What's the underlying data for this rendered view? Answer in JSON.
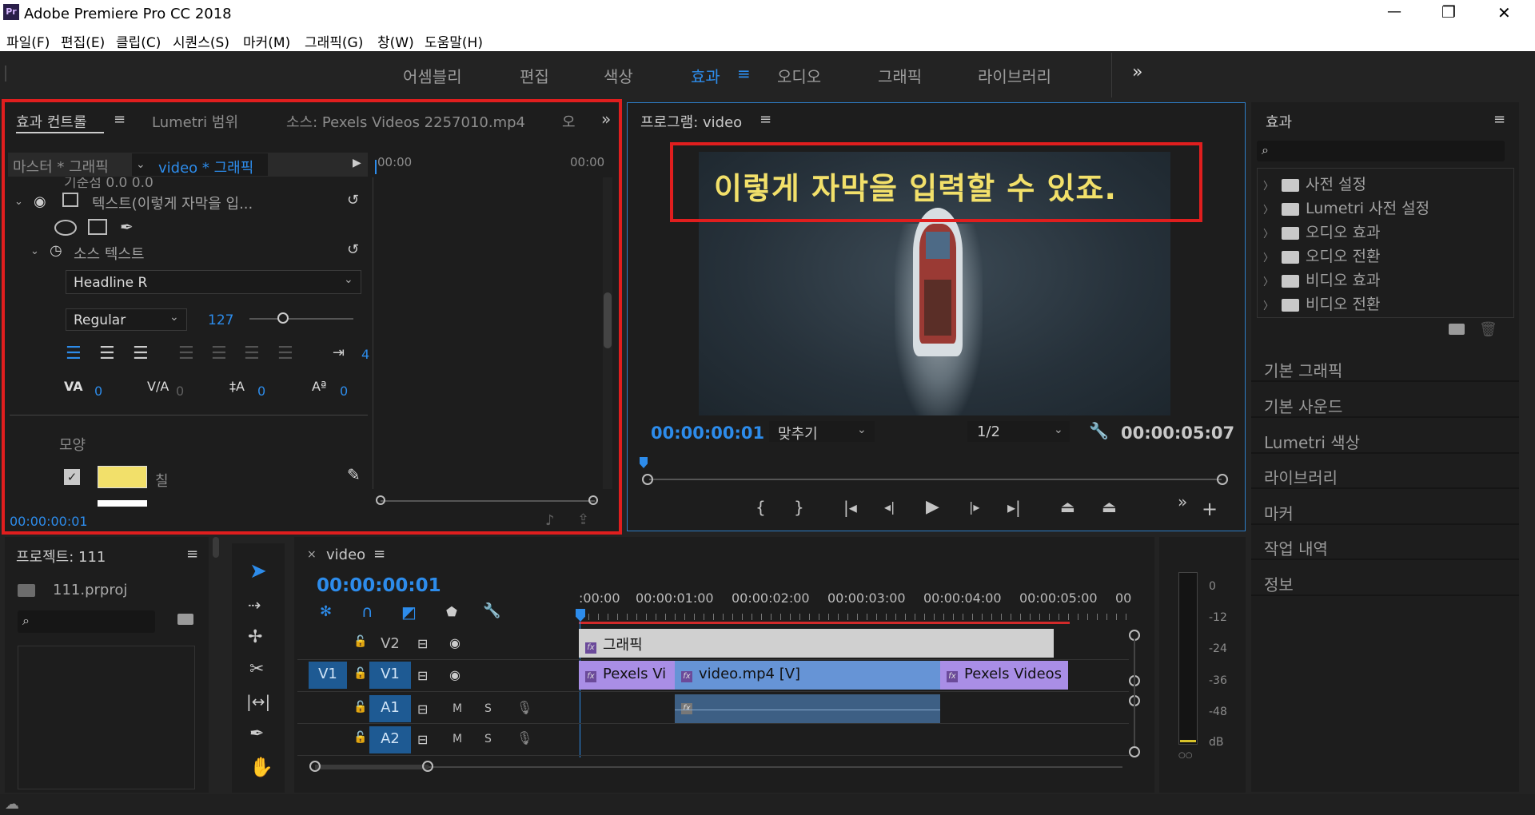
{
  "app": {
    "title": "Adobe Premiere Pro CC 2018",
    "logo": "Pr"
  },
  "window": {
    "minimize": "—",
    "restore": "❐",
    "close": "✕"
  },
  "menu": [
    "파일(F)",
    "편집(E)",
    "클립(C)",
    "시퀀스(S)",
    "마커(M)",
    "그래픽(G)",
    "창(W)",
    "도움말(H)"
  ],
  "workspaces": {
    "items": [
      "어셈블리",
      "편집",
      "색상",
      "효과",
      "오디오",
      "그래픽",
      "라이브러리"
    ],
    "active": "효과",
    "more": "»"
  },
  "effect_controls": {
    "tabs": [
      "효과 컨트롤",
      "Lumetri 범위",
      "소스: Pexels Videos 2257010.mp4",
      "오"
    ],
    "master": "마스터 * 그래픽",
    "sequence_clip": "video * 그래픽",
    "time_start": "00:00",
    "time_end": "00:00",
    "cut_row": "기준점      0.0        0.0",
    "text_layer": "텍스트(이렇게 자막을 입...",
    "source_text": "소스 텍스트",
    "font": "Headline R",
    "style": "Regular",
    "size": "127",
    "tracking_value": "4",
    "kerning": "0",
    "tracking": "0",
    "leading": "0",
    "baseline": "0",
    "appearance": "모양",
    "fill_label": "칠",
    "fill_color": "#f2e06a",
    "timecode": "00:00:00:01"
  },
  "program": {
    "title": "프로그램: video",
    "subtitle": "이렇게 자막을 입력할 수 있죠.",
    "timecode": "00:00:00:01",
    "fit": "맞추기",
    "resolution": "1/2",
    "duration": "00:00:05:07"
  },
  "effects_panel": {
    "title": "효과",
    "items": [
      "사전 설정",
      "Lumetri 사전 설정",
      "오디오 효과",
      "오디오 전환",
      "비디오 효과",
      "비디오 전환"
    ]
  },
  "right_panels": [
    "기본 그래픽",
    "기본 사운드",
    "Lumetri 색상",
    "라이브러리",
    "마커",
    "작업 내역",
    "정보"
  ],
  "project": {
    "title": "프로젝트: 111",
    "file": "111.prproj"
  },
  "timeline": {
    "title": "video",
    "timecode": "00:00:00:01",
    "ruler": [
      ":00:00",
      "00:00:01:00",
      "00:00:02:00",
      "00:00:03:00",
      "00:00:04:00",
      "00:00:05:00",
      "00"
    ],
    "tracks": {
      "v2": "V2",
      "v1_src": "V1",
      "v1": "V1",
      "a1": "A1",
      "a2": "A2",
      "m": "M",
      "s": "S"
    },
    "clips": {
      "graphic": "그래픽",
      "left": "Pexels Vi",
      "center": "video.mp4 [V]",
      "right": "Pexels Videos"
    }
  },
  "meter": {
    "labels": [
      "0",
      "-12",
      "-24",
      "-36",
      "-48",
      "dB"
    ]
  }
}
